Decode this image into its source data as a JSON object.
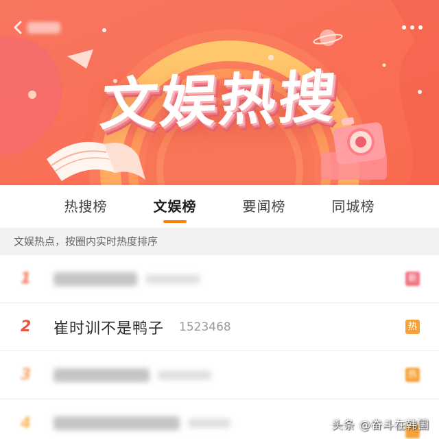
{
  "banner": {
    "title": "文娱热搜",
    "back_icon": "chevron-left-icon",
    "more_icon": "more-dots-icon"
  },
  "tabs": [
    {
      "label": "热搜榜",
      "active": false
    },
    {
      "label": "文娱榜",
      "active": true
    },
    {
      "label": "要闻榜",
      "active": false
    },
    {
      "label": "同城榜",
      "active": false
    }
  ],
  "subtitle": "文娱热点，按圈内实时热度排序",
  "list": [
    {
      "rank": "1",
      "blurred": true,
      "badge": "新",
      "rank_color": "#f4704f",
      "badge_color": "#ef7380"
    },
    {
      "rank": "2",
      "blurred": false,
      "title": "崔时训不是鸭子",
      "count": "1523468",
      "badge": "热",
      "rank_color": "#ea5540",
      "badge_color": "#f6a23a"
    },
    {
      "rank": "3",
      "blurred": true,
      "badge": "热",
      "rank_color": "#f5a36a",
      "badge_color": "#f6a23a"
    },
    {
      "rank": "4",
      "blurred": true,
      "badge": "",
      "rank_color": "#f7b85e",
      "badge_color": "#f6a23a"
    }
  ],
  "watermark": "头条 @奋斗在韩国",
  "colors": {
    "accent": "#ff8200",
    "banner_top": "#f7765f",
    "banner_bottom": "#f96a4e",
    "subtitle_bg": "#f2f2f2"
  }
}
